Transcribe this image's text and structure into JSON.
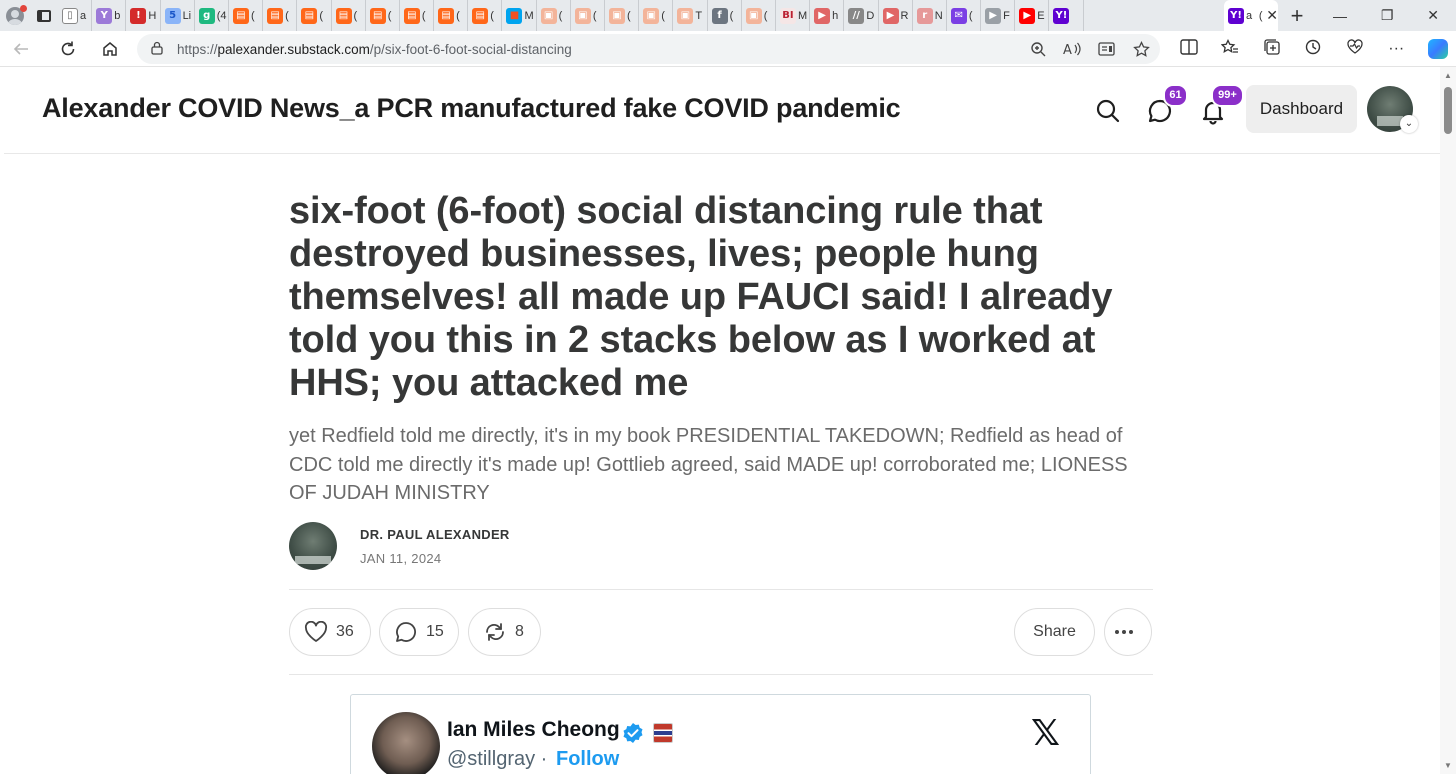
{
  "browser": {
    "active_tab_title": "a",
    "active_tab_marker": "(",
    "tabs": [
      {
        "letter": "a",
        "color": "#ffffff",
        "glyph": "▯",
        "glyph_color": "#666"
      },
      {
        "letter": "b",
        "color": "#9c7ad8",
        "glyph": "Y",
        "glyph_color": "#fff"
      },
      {
        "letter": "H",
        "color": "#d42b2b",
        "glyph": "!",
        "glyph_color": "#fff"
      },
      {
        "letter": "Li",
        "color": "#8ab4f8",
        "glyph": "5",
        "glyph_color": "#1a56c8"
      },
      {
        "letter": "(4",
        "color": "#1eb980",
        "glyph": "g",
        "glyph_color": "#fff"
      },
      {
        "letter": "(",
        "color": "#ff6719",
        "glyph": "▤",
        "glyph_color": "#fff"
      },
      {
        "letter": "(",
        "color": "#ff6719",
        "glyph": "▤",
        "glyph_color": "#fff"
      },
      {
        "letter": "(",
        "color": "#ff6719",
        "glyph": "▤",
        "glyph_color": "#fff"
      },
      {
        "letter": "(",
        "color": "#ff6719",
        "glyph": "▤",
        "glyph_color": "#fff"
      },
      {
        "letter": "(",
        "color": "#ff6719",
        "glyph": "▤",
        "glyph_color": "#fff"
      },
      {
        "letter": "(",
        "color": "#ff6719",
        "glyph": "▤",
        "glyph_color": "#fff"
      },
      {
        "letter": "(",
        "color": "#ff6719",
        "glyph": "▤",
        "glyph_color": "#fff"
      },
      {
        "letter": "(",
        "color": "#ff6719",
        "glyph": "▤",
        "glyph_color": "#fff"
      },
      {
        "letter": "M",
        "color": "#00a4ef",
        "glyph": "■",
        "glyph_color": "#f25022"
      },
      {
        "letter": "(",
        "color": "#f3b49a",
        "glyph": "▣",
        "glyph_color": "#fff"
      },
      {
        "letter": "(",
        "color": "#f3b49a",
        "glyph": "▣",
        "glyph_color": "#fff"
      },
      {
        "letter": "(",
        "color": "#f3b49a",
        "glyph": "▣",
        "glyph_color": "#fff"
      },
      {
        "letter": "(",
        "color": "#f3b49a",
        "glyph": "▣",
        "glyph_color": "#fff"
      },
      {
        "letter": "T",
        "color": "#f3b49a",
        "glyph": "▣",
        "glyph_color": "#fff"
      },
      {
        "letter": "(",
        "color": "#6c7580",
        "glyph": "f",
        "glyph_color": "#fff"
      },
      {
        "letter": "(",
        "color": "#f3b49a",
        "glyph": "▣",
        "glyph_color": "#fff"
      },
      {
        "letter": "M",
        "color": "#f5e6e6",
        "glyph": "BI",
        "glyph_color": "#b23"
      },
      {
        "letter": "h",
        "color": "#e06666",
        "glyph": "▶",
        "glyph_color": "#fff"
      },
      {
        "letter": "D",
        "color": "#888",
        "glyph": "//",
        "glyph_color": "#fff"
      },
      {
        "letter": "R",
        "color": "#e06666",
        "glyph": "▶",
        "glyph_color": "#fff"
      },
      {
        "letter": "N",
        "color": "#e69999",
        "glyph": "r",
        "glyph_color": "#fff"
      },
      {
        "letter": "(",
        "color": "#7b3fe4",
        "glyph": "✉",
        "glyph_color": "#fff"
      },
      {
        "letter": "F",
        "color": "#9aa0a6",
        "glyph": "▶",
        "glyph_color": "#fff"
      },
      {
        "letter": "E",
        "color": "#ff0000",
        "glyph": "▶",
        "glyph_color": "#fff"
      },
      {
        "letter": "",
        "color": "#5f01d1",
        "glyph": "Y!",
        "glyph_color": "#fff"
      }
    ],
    "new_tab": "+",
    "window_controls": [
      "—",
      "❐",
      "✕"
    ],
    "url_prefix": "https://",
    "url_host": "palexander.substack.com",
    "url_path": "/p/six-foot-6-foot-social-distancing"
  },
  "header": {
    "site_title": "Alexander COVID News_a PCR manufactured fake COVID pandemic",
    "chat_badge": "61",
    "bell_badge": "99+",
    "dashboard_label": "Dashboard",
    "avatar_chevron": "⌄"
  },
  "post": {
    "title": "six-foot (6-foot) social distancing rule that destroyed businesses, lives; people hung themselves! all made up FAUCI said! I already told you this in 2 stacks below as I worked at HHS; you attacked me",
    "subtitle": "yet Redfield told me directly, it's in my book PRESIDENTIAL TAKEDOWN; Redfield as head of CDC told me directly it's made up! Gottlieb agreed, said MADE up! corroborated me; LIONESS OF JUDAH MINISTRY",
    "author": "DR. PAUL ALEXANDER",
    "date": "JAN 11, 2024",
    "likes": "36",
    "comments": "15",
    "restacks": "8",
    "share_label": "Share"
  },
  "tweet": {
    "name": "Ian Miles Cheong",
    "handle": "@stillgray",
    "separator": "·",
    "follow_label": "Follow",
    "x_logo": "𝕏"
  },
  "colors": {
    "badge": "#8b2fc9",
    "twitter_blue": "#1d9bf0"
  }
}
